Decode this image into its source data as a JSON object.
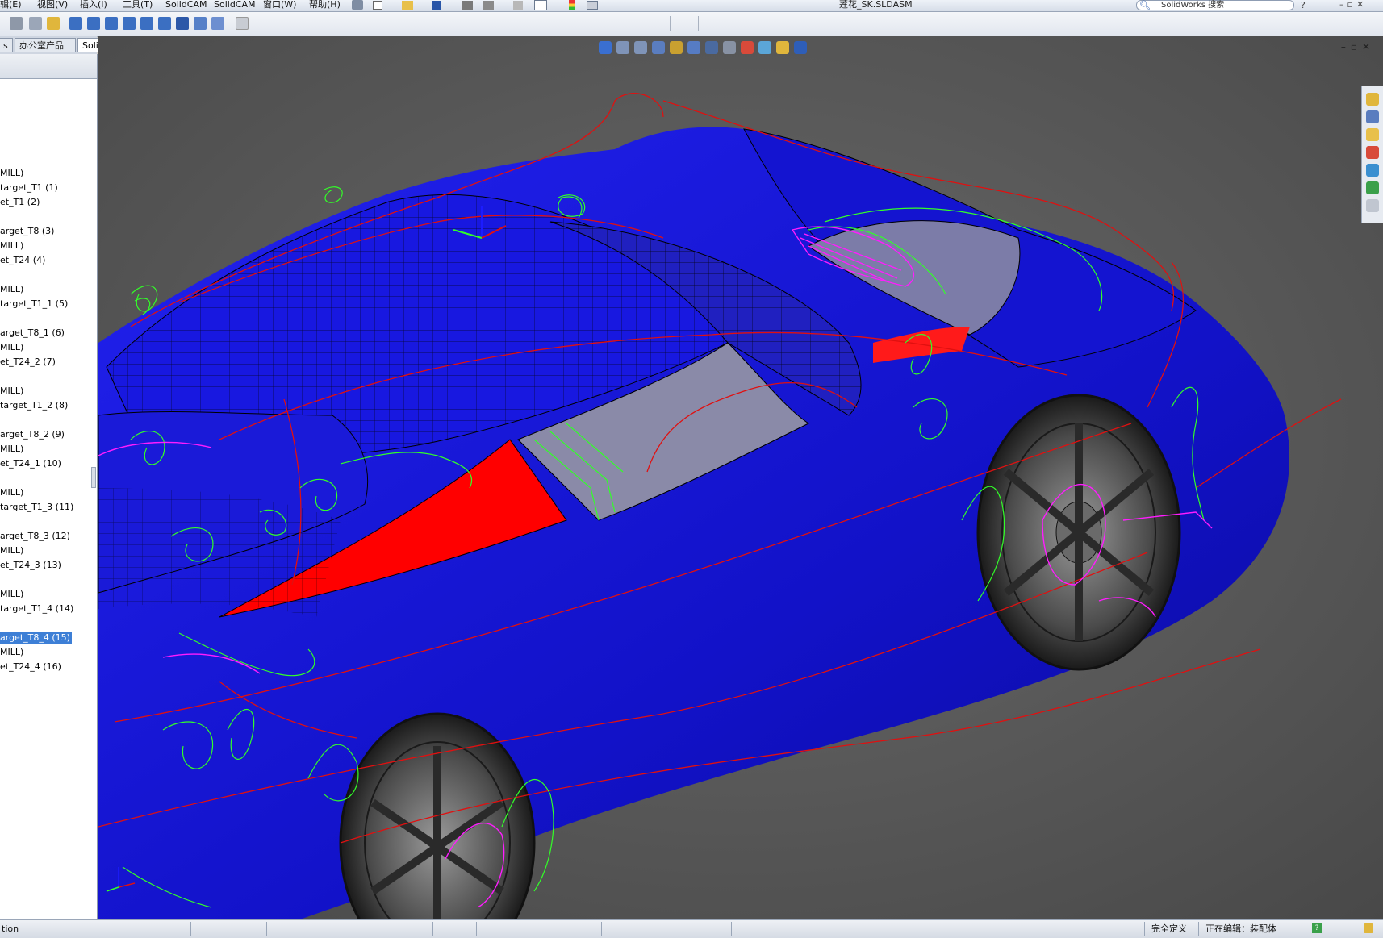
{
  "menu": [
    "辑(E)",
    "视图(V)",
    "插入(I)",
    "工具(T)",
    "SolidCAM",
    "SolidCAM",
    "窗口(W)",
    "帮助(H)"
  ],
  "window": {
    "title": "莲花_SK.SLDASM"
  },
  "search": {
    "label": "SolidWorks 搜索"
  },
  "tabs": [
    {
      "label": "s"
    },
    {
      "label": "办公室产品"
    },
    {
      "label": "SolidCAM"
    }
  ],
  "tree": {
    "items": [
      {
        "label": " MILL)"
      },
      {
        "label": "target_T1 (1)"
      },
      {
        "label": "et_T1 (2)"
      },
      {
        "label": "arget_T8 (3)"
      },
      {
        "label": " MILL)"
      },
      {
        "label": "et_T24 (4)"
      },
      {
        "label": " MILL)"
      },
      {
        "label": "target_T1_1 (5)"
      },
      {
        "label": "arget_T8_1 (6)"
      },
      {
        "label": " MILL)"
      },
      {
        "label": "et_T24_2 (7)"
      },
      {
        "label": " MILL)"
      },
      {
        "label": "target_T1_2 (8)"
      },
      {
        "label": "arget_T8_2 (9)"
      },
      {
        "label": " MILL)"
      },
      {
        "label": "et_T24_1 (10)"
      },
      {
        "label": " MILL)"
      },
      {
        "label": "target_T1_3 (11)"
      },
      {
        "label": "arget_T8_3 (12)"
      },
      {
        "label": " MILL)"
      },
      {
        "label": "et_T24_3 (13)"
      },
      {
        "label": " MILL)"
      },
      {
        "label": "target_T1_4 (14)"
      },
      {
        "label": "arget_T8_4 (15)",
        "selected": true
      },
      {
        "label": " MILL)"
      },
      {
        "label": "et_T24_4 (16)"
      }
    ]
  },
  "status": {
    "left": "tion",
    "constraint": "完全定义",
    "editing": "正在编辑：装配体"
  },
  "icons": {
    "search": "search-icon",
    "home": "home-icon",
    "palette": "palette-icon",
    "folder": "folder-icon",
    "help": "help-icon"
  },
  "colors": {
    "car_body": "#1414d8",
    "toolpath_green": "#32ff28",
    "toolpath_magenta": "#ff1cff",
    "rapid_red": "#e01010",
    "background": "#5b5b5b",
    "selection": "#3d7fd6"
  }
}
